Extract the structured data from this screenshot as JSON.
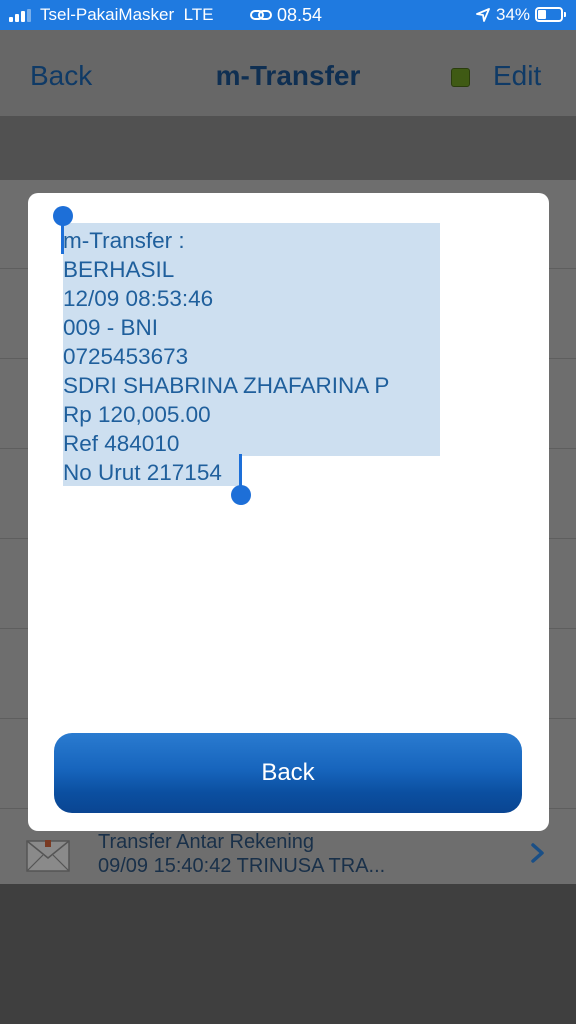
{
  "status_bar": {
    "carrier": "Tsel-PakaiMasker",
    "network": "LTE",
    "time": "08.54",
    "battery_percent": "34%",
    "signal_bars": 3,
    "battery_level": 0.34,
    "icons": [
      "signal-bars-icon",
      "link-icon",
      "location-arrow-icon",
      "battery-icon"
    ]
  },
  "navbar": {
    "back_label": "Back",
    "title": "m-Transfer",
    "edit_label": "Edit",
    "indicator_color": "#3f5a14"
  },
  "list": {
    "item": {
      "title": "Transfer Antar Rekening",
      "subtitle": "09/09 15:40:42 TRINUSA TRA...",
      "icon": "envelope-icon",
      "chevron": "chevron-right-icon"
    }
  },
  "modal": {
    "lines": [
      "m-Transfer :",
      "BERHASIL",
      "12/09 08:53:46",
      "009 - BNI",
      "0725453673",
      "SDRI SHABRINA ZHAFARINA P",
      "Rp 120,005.00",
      "Ref 484010",
      "No Urut 217154"
    ],
    "back_button_label": "Back",
    "selection_color": "#cddff0",
    "accent_color": "#1d6fd8"
  }
}
